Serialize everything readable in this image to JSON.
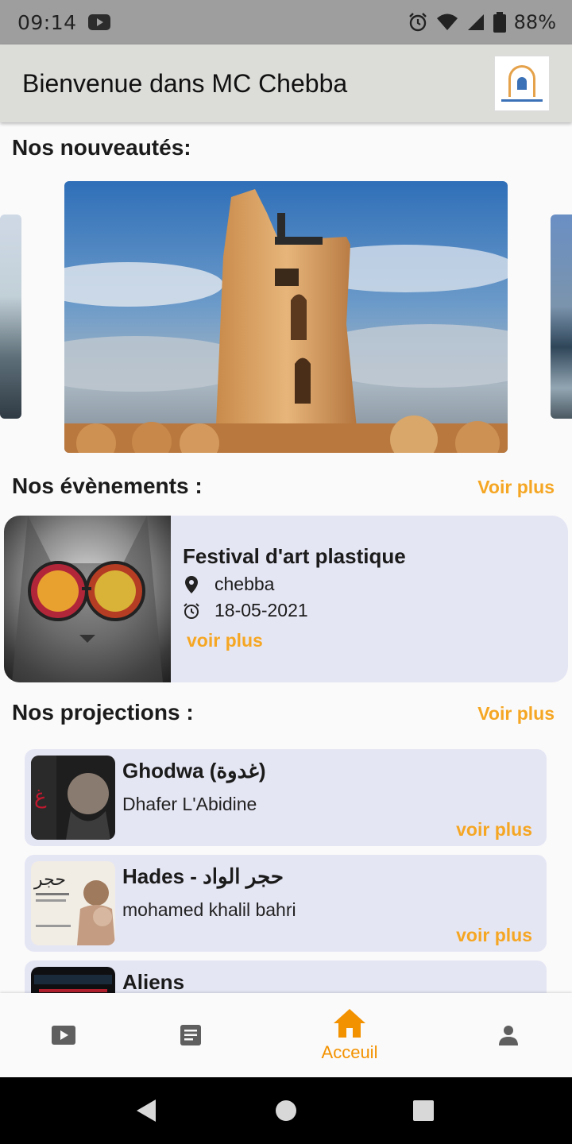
{
  "status_bar": {
    "time": "09:14",
    "battery_percent": "88%",
    "icons": [
      "youtube-icon",
      "alarm-icon",
      "wifi-icon",
      "signal-icon",
      "battery-icon"
    ]
  },
  "app_bar": {
    "title": "Bienvenue dans MC Chebba",
    "logo_icon": "mc-chebba-logo"
  },
  "nouveautes": {
    "title": "Nos nouveautés:",
    "slides": [
      "tower-photo"
    ]
  },
  "evenements": {
    "title": "Nos évènements :",
    "more_label": "Voir plus",
    "items": [
      {
        "title": "Festival d'art plastique",
        "location": "chebba",
        "date": "18-05-2021",
        "more_label": "voir plus"
      }
    ]
  },
  "projections": {
    "title": "Nos projections :",
    "more_label": "Voir plus",
    "items": [
      {
        "title": "Ghodwa (غدوة)",
        "subtitle": "Dhafer L'Abidine",
        "more_label": "voir plus"
      },
      {
        "title": "Hades - حجر الواد",
        "subtitle": "mohamed khalil bahri",
        "more_label": "voir plus"
      },
      {
        "title": "Aliens",
        "subtitle": "",
        "more_label": ""
      }
    ]
  },
  "bottom_nav": {
    "items": [
      {
        "icon": "video-icon",
        "label": ""
      },
      {
        "icon": "article-icon",
        "label": ""
      },
      {
        "icon": "home-icon",
        "label": "Acceuil",
        "active": true
      },
      {
        "icon": "person-icon",
        "label": ""
      }
    ],
    "active_color": "#f39200",
    "inactive_color": "#5f5f5f"
  },
  "colors": {
    "accent": "#f5a623",
    "card_bg": "#e5e6f4",
    "app_bar_bg": "#dcdcd9",
    "status_bar_bg": "#9e9e9e"
  }
}
